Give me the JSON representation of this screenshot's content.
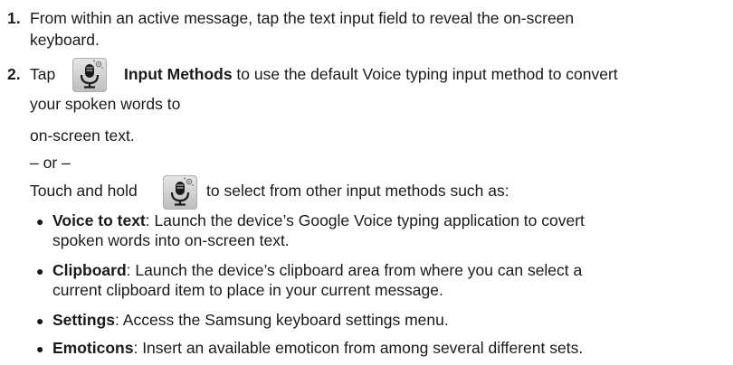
{
  "step1": {
    "number": "1.",
    "line1": "From within an active message, tap the text input field to reveal the on-screen",
    "line2": "keyboard."
  },
  "step2": {
    "number": "2.",
    "tap": "Tap",
    "bold": "Input Methods",
    "rest": " to use the default Voice typing input method to convert",
    "line2": "your spoken words to",
    "line3": "on-screen text.",
    "or": "– or –",
    "touch_before": "Touch and hold",
    "touch_after": "to select from other input methods such as:"
  },
  "bullets": [
    {
      "term": "Voice to text",
      "text": ": Launch the device’s Google Voice typing application to covert",
      "cont": "spoken words into on-screen text."
    },
    {
      "term": "Clipboard",
      "text": ": Launch the device’s clipboard area from where you can select a",
      "cont": "current clipboard item to place in your current message."
    },
    {
      "term": "Settings",
      "text": ": Access the Samsung keyboard settings menu.",
      "cont": ""
    },
    {
      "term": "Emoticons",
      "text": ": Insert an available emoticon from among several different sets.",
      "cont": ""
    }
  ],
  "icons": {
    "mic": "microphone-settings-icon"
  }
}
